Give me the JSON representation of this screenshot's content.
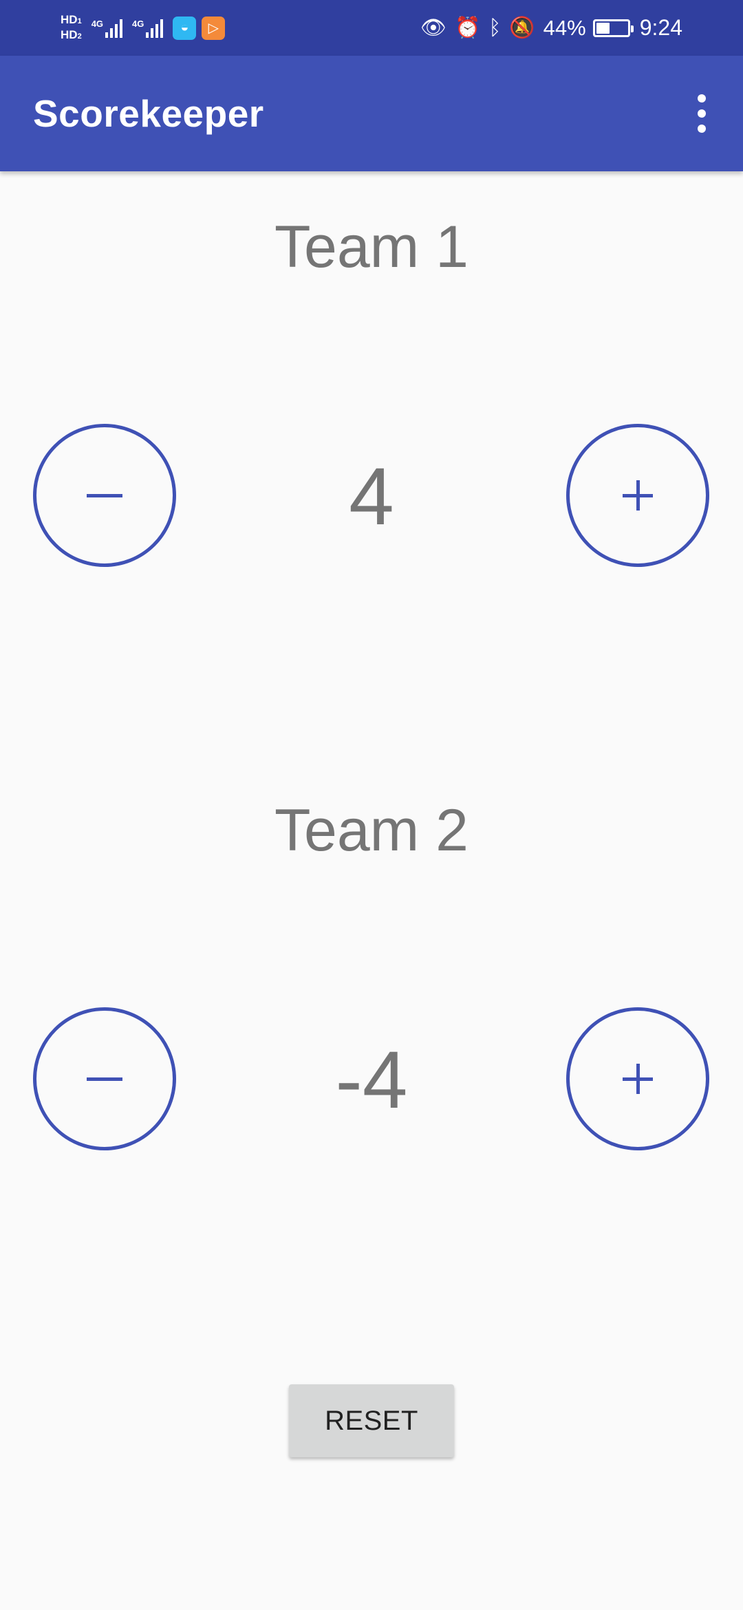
{
  "status_bar": {
    "sim1_label": "HD",
    "sim1_index": "1",
    "sim2_label": "HD",
    "sim2_index": "2",
    "network1": "4G",
    "network2": "4G",
    "battery_percent": "44%",
    "battery_level": 0.44,
    "time": "9:24",
    "icons": [
      "eye-icon",
      "alarm-icon",
      "bluetooth-icon",
      "notifications-off-icon"
    ],
    "app_icons": [
      "qq-browser-icon",
      "video-player-icon"
    ]
  },
  "app_bar": {
    "title": "Scorekeeper",
    "background": "#3f51b5",
    "status_background": "#303f9f"
  },
  "teams": [
    {
      "name": "Team 1",
      "score": "4"
    },
    {
      "name": "Team 2",
      "score": "-4"
    }
  ],
  "controls": {
    "minus_icon": "minus-icon",
    "plus_icon": "plus-icon",
    "accent_color": "#3f51b5"
  },
  "reset": {
    "label": "RESET"
  }
}
